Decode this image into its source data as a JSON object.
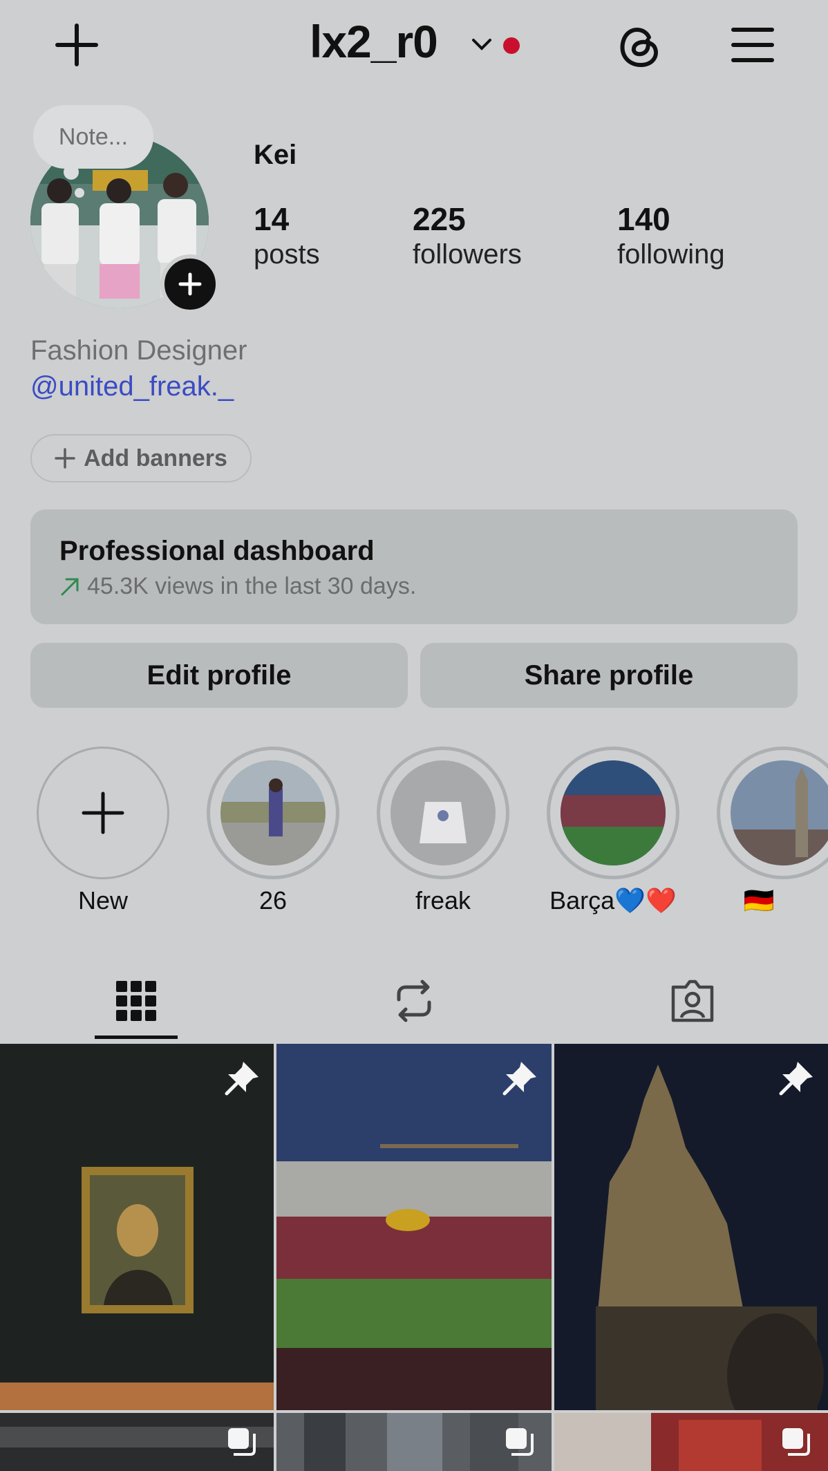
{
  "header": {
    "username": "lx2_r0",
    "icons": [
      "plus-icon",
      "chevron-down-icon",
      "threads-icon",
      "menu-icon"
    ],
    "notification_dot_color": "#c8102e"
  },
  "profile": {
    "note_placeholder": "Note...",
    "name": "Kei",
    "stats": [
      {
        "value": "14",
        "label": "posts"
      },
      {
        "value": "225",
        "label": "followers"
      },
      {
        "value": "140",
        "label": "following"
      }
    ],
    "bio": "Fashion Designer",
    "link": "@united_freak._",
    "link_color": "#3a4bc4"
  },
  "add_banners": {
    "label": "Add banners"
  },
  "dashboard": {
    "title": "Professional dashboard",
    "subtitle": "45.3K views in the last 30 days.",
    "trend_color": "#2e8b4e"
  },
  "actions": {
    "edit": "Edit profile",
    "share": "Share profile"
  },
  "highlights": [
    {
      "label": "New"
    },
    {
      "label": "26"
    },
    {
      "label": "freak"
    },
    {
      "label": "Barça💙❤️"
    },
    {
      "label": "🇩🇪"
    }
  ],
  "tabs": [
    "grid-icon",
    "reposts-icon",
    "tagged-icon"
  ],
  "grid": [
    {
      "subject": "Mona Lisa painting",
      "pinned": true
    },
    {
      "subject": "Football stadium",
      "pinned": true
    },
    {
      "subject": "Cathedral at night",
      "pinned": true
    },
    {
      "subject": "Post 4",
      "multi": true
    },
    {
      "subject": "Post 5",
      "multi": true
    },
    {
      "subject": "Post 6",
      "multi": true
    }
  ]
}
